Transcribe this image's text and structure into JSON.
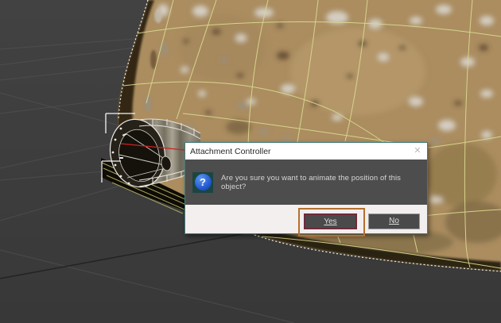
{
  "dialog": {
    "title": "Attachment Controller",
    "close_glyph": "✕",
    "icon_glyph": "?",
    "message": "Are you sure you want to animate the position of this object?",
    "buttons": {
      "yes": "Yes",
      "no": "No"
    }
  },
  "annotation": {
    "color": "#b5702e",
    "target": "yes-button"
  },
  "viewport": {
    "background": "#3b3b3b",
    "wireframe_color": "#d9d98e",
    "selection_edge_color": "#f0f0ea",
    "controller_line_color": "#cc2222",
    "objects": [
      "textured-dome-mesh",
      "cylinder-attachment-object"
    ]
  }
}
